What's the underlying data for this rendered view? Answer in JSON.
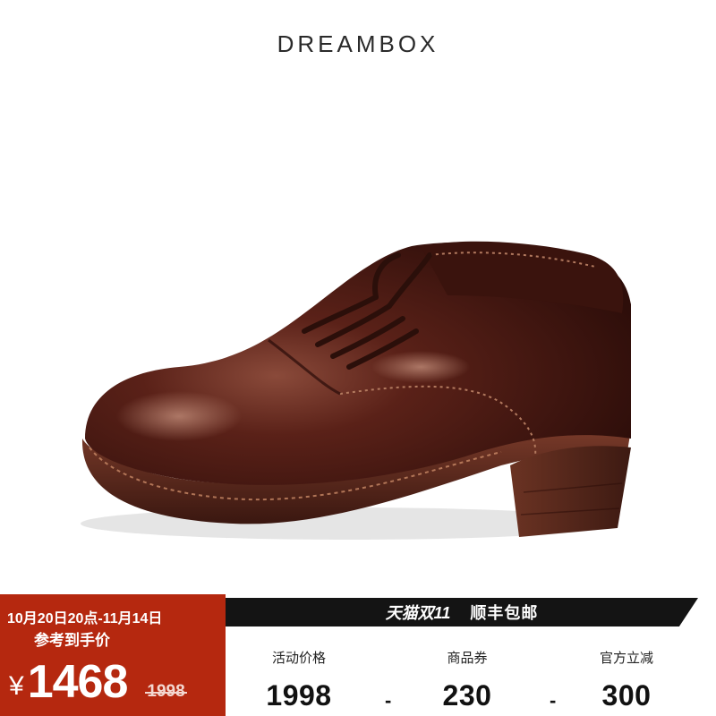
{
  "brand": {
    "name": "DREAMBOX"
  },
  "product": {
    "image_subject": "brown-leather-derby-shoe-icon"
  },
  "price_panel": {
    "date_range": "10月20日20点-11月14日",
    "ref_label": "参考到手价",
    "currency": "¥",
    "price": "1468",
    "original_price": "1998"
  },
  "promo_banner": {
    "event": "天猫双11",
    "shipping": "顺丰包邮"
  },
  "breakdown": {
    "items": [
      {
        "label": "活动价格",
        "value": "1998"
      },
      {
        "label": "商品券",
        "value": "230"
      },
      {
        "label": "官方立减",
        "value": "300"
      }
    ],
    "operators": [
      "-",
      "-"
    ]
  },
  "colors": {
    "accent_red": "#b5280f",
    "banner_dark": "#141414",
    "leather_brown": "#4a1a12"
  }
}
